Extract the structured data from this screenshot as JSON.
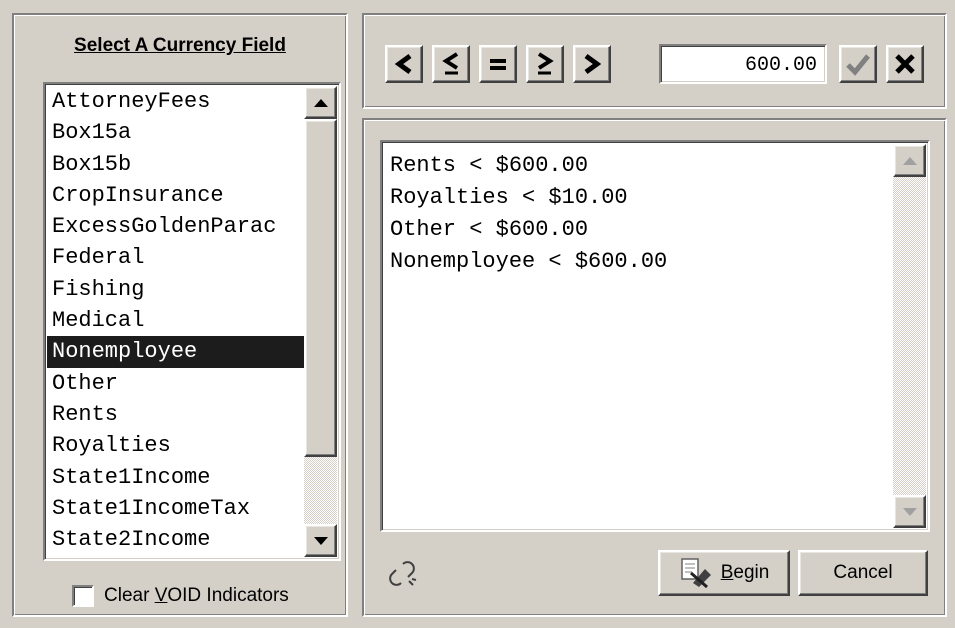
{
  "left_panel": {
    "title": "Select A Currency Field",
    "fields": [
      "AttorneyFees",
      "Box15a",
      "Box15b",
      "CropInsurance",
      "ExcessGoldenParac",
      "Federal",
      "Fishing",
      "Medical",
      "Nonemployee",
      "Other",
      "Rents",
      "Royalties",
      "State1Income",
      "State1IncomeTax",
      "State2Income"
    ],
    "selected_index": 8,
    "clear_void_label_pre": "Clear ",
    "clear_void_label_mnemonic": "V",
    "clear_void_label_post": "OID Indicators",
    "clear_void_checked": false
  },
  "toolbar": {
    "buttons": [
      {
        "icon": "less-than-icon",
        "glyph": "<"
      },
      {
        "icon": "less-equal-icon",
        "glyph": "≤"
      },
      {
        "icon": "equals-icon",
        "glyph": "="
      },
      {
        "icon": "greater-equal-icon",
        "glyph": "≥"
      },
      {
        "icon": "greater-than-icon",
        "glyph": ">"
      }
    ],
    "value": "600.00",
    "accept_icon": "checkmark-icon",
    "reject_icon": "x-icon"
  },
  "criteria": {
    "lines": [
      "Rents < $600.00",
      "Royalties < $10.00",
      "Other < $600.00",
      "Nonemployee < $600.00"
    ]
  },
  "actions": {
    "link_icon": "broken-link-icon",
    "begin_mnemonic": "B",
    "begin_rest": "egin",
    "cancel_label": "Cancel"
  }
}
